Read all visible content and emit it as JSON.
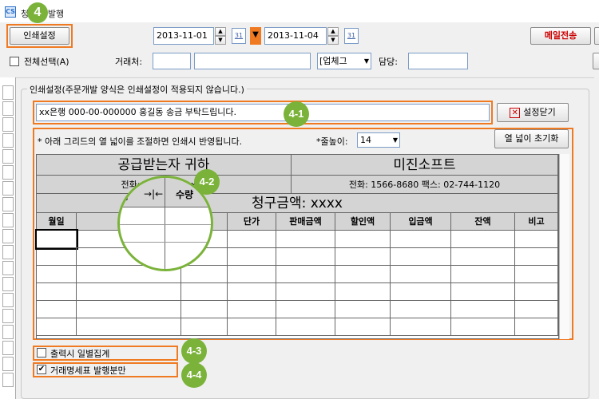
{
  "window": {
    "title": "청구서 발행",
    "icon_text": "CS"
  },
  "toolbar": {
    "print_settings_label": "인쇄설정",
    "date_from": "2013-11-01",
    "date_to": "2013-11-04",
    "calendar_label": "31",
    "email_label": "메일전송"
  },
  "filter": {
    "select_all_label": "전체선택(A)",
    "client_label": "거래처:",
    "business_type_value": "[업체그",
    "manager_label": "담당:"
  },
  "print_panel": {
    "group_title": "인쇄설정(주문개발 양식은 인쇄설정이 적용되지 않습니다.)",
    "message_value": "xx은행 000-00-000000 홍길동 송금 부탁드립니다.",
    "close_label": "설정닫기",
    "hint_text": "* 아래 그리드의 열 넓이를 조절하면 인쇄시 반영됩니다.",
    "row_height_label": "*줄높이:",
    "row_height_value": "14",
    "reset_width_label": "열 넓이 초기화",
    "daily_total_label": "출력시 일별집계",
    "statement_only_label": "거래명세표 발행분만"
  },
  "grid": {
    "recipient_title": "공급받는자 귀하",
    "recipient_phone": "전화: xxx-xxxx-xxxx",
    "supplier_name": "미진소프트",
    "supplier_phone": "전화: 1566-8680   팩스: 02-744-1120",
    "claim_amount": "청구금액: xxxx",
    "columns": [
      "월일",
      "품명",
      "수량",
      "단가",
      "판매금액",
      "할인액",
      "입금액",
      "잔액",
      "비고"
    ]
  },
  "magnifier": {
    "left_text": "명",
    "arrow": "→|←",
    "right_text": "수량"
  },
  "badges": {
    "b4": "4",
    "b41": "4-1",
    "b42": "4-2",
    "b43": "4-3",
    "b44": "4-4"
  },
  "colors": {
    "highlight": "#f07a22",
    "badge": "#7bb33a",
    "email_red": "#cc0000"
  }
}
